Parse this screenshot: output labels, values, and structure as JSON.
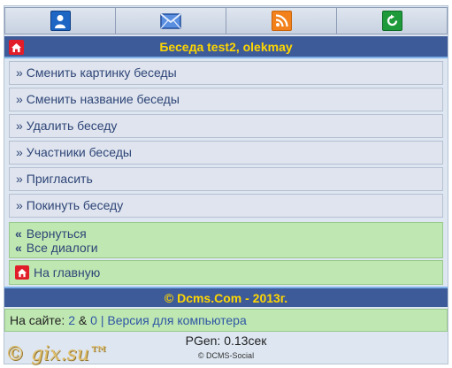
{
  "title": "Беседа test2, olekmay",
  "nav_icons": [
    "user-icon",
    "mail-icon",
    "rss-icon",
    "refresh-icon"
  ],
  "menu": [
    "Сменить картинку беседы",
    "Сменить название беседы",
    "Удалить беседу",
    "Участники беседы",
    "Пригласить",
    "Покинуть беседу"
  ],
  "menu_arrow": "»",
  "back": {
    "dq": "«",
    "return_label": "Вернуться",
    "all_dialogs_label": "Все диалоги"
  },
  "home_label": "На главную",
  "footer": "© Dcms.Com - 2013г.",
  "online": {
    "prefix": "На сайте:",
    "count_a": "2",
    "amp": "&",
    "count_b": "0",
    "sep": "|",
    "desktop_label": "Версия для компьютера"
  },
  "pgen": "PGen: 0.13сек",
  "social": "© DCMS-Social",
  "watermark": "© gix.su™",
  "colors": {
    "header": "#3d5a99",
    "title_text": "#ffd700",
    "green_panel": "#bfe7b1",
    "menu_bg": "#dfe4ee"
  }
}
